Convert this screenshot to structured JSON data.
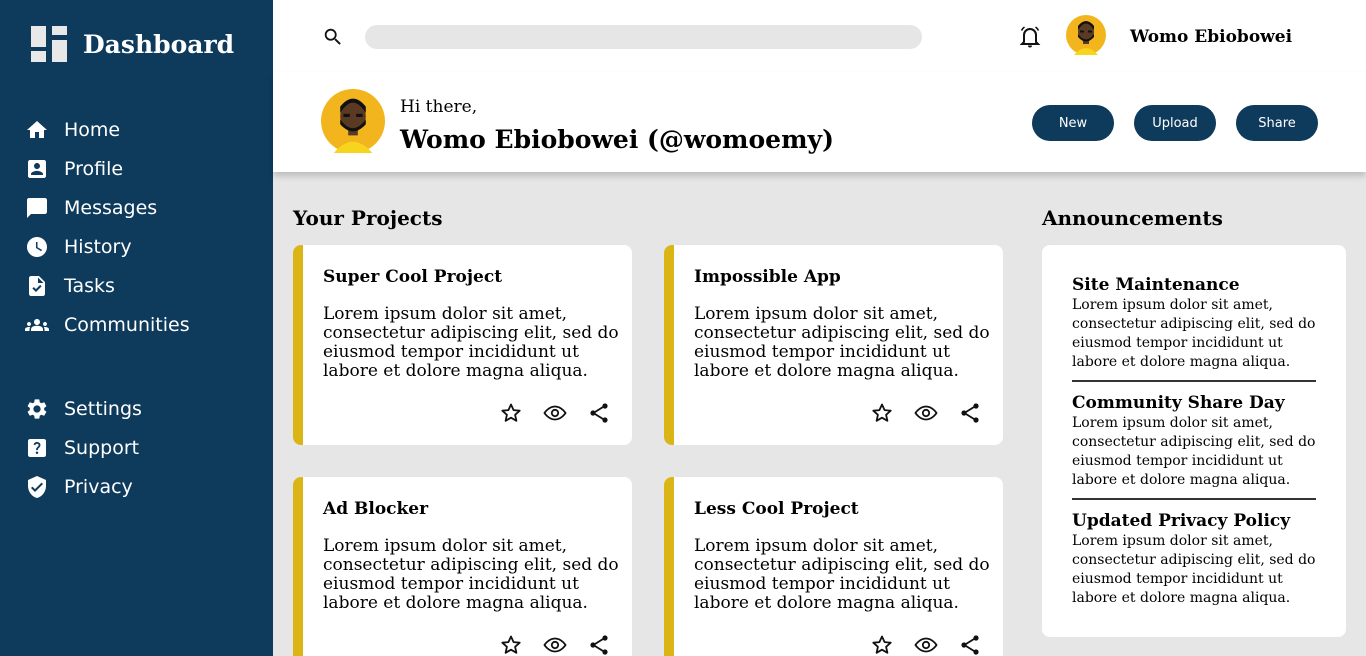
{
  "sidebar": {
    "brand": "Dashboard",
    "items": [
      {
        "label": "Home",
        "icon": "home-icon"
      },
      {
        "label": "Profile",
        "icon": "profile-icon"
      },
      {
        "label": "Messages",
        "icon": "messages-icon"
      },
      {
        "label": "History",
        "icon": "history-icon"
      },
      {
        "label": "Tasks",
        "icon": "tasks-icon"
      },
      {
        "label": "Communities",
        "icon": "communities-icon"
      },
      {
        "label": "Settings",
        "icon": "gear-icon"
      },
      {
        "label": "Support",
        "icon": "help-icon"
      },
      {
        "label": "Privacy",
        "icon": "shield-icon"
      }
    ]
  },
  "header": {
    "search_placeholder": "",
    "user_name": "Womo Ebiobowei"
  },
  "greeting": {
    "hi": "Hi there,",
    "full_name": "Womo Ebiobowei (@womoemy)",
    "buttons": [
      "New",
      "Upload",
      "Share"
    ]
  },
  "projects": {
    "title": "Your Projects",
    "items": [
      {
        "title": "Super Cool Project",
        "body": "Lorem ipsum dolor sit amet, consectetur adipiscing elit, sed do eiusmod tempor incididunt ut labore et dolore magna aliqua."
      },
      {
        "title": "Impossible App",
        "body": "Lorem ipsum dolor sit amet, consectetur adipiscing elit, sed do eiusmod tempor incididunt ut labore et dolore magna aliqua."
      },
      {
        "title": "Ad Blocker",
        "body": "Lorem ipsum dolor sit amet, consectetur adipiscing elit, sed do eiusmod tempor incididunt ut labore et dolore magna aliqua."
      },
      {
        "title": "Less Cool Project",
        "body": "Lorem ipsum dolor sit amet, consectetur adipiscing elit, sed do eiusmod tempor incididunt ut labore et dolore magna aliqua."
      }
    ]
  },
  "announcements": {
    "title": "Announcements",
    "items": [
      {
        "title": "Site Maintenance",
        "body": "Lorem ipsum dolor sit amet, consectetur adipiscing elit, sed do eiusmod tempor incididunt ut labore et dolore magna aliqua."
      },
      {
        "title": "Community Share Day",
        "body": "Lorem ipsum dolor sit amet, consectetur adipiscing elit, sed do eiusmod tempor incididunt ut labore et dolore magna aliqua."
      },
      {
        "title": "Updated Privacy Policy",
        "body": "Lorem ipsum dolor sit amet, consectetur adipiscing elit, sed do eiusmod tempor incididunt ut labore et dolore magna aliqua."
      }
    ]
  },
  "colors": {
    "sidebar": "#0e3a5c",
    "accent": "#dbb515",
    "background": "#e6e6e6",
    "avatar": "#f2b51d"
  }
}
